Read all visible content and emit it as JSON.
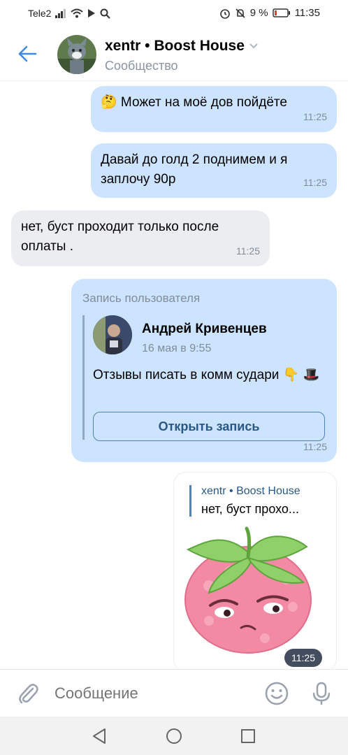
{
  "status_bar": {
    "carrier": "Tele2",
    "battery": "9 %",
    "time": "11:35"
  },
  "header": {
    "title": "xentr • Boost House",
    "subtitle": "Сообщество"
  },
  "messages": [
    {
      "text": "🤔 Может на моё дов пойдёте",
      "time": "11:25",
      "direction": "out"
    },
    {
      "text": "Давай до голд 2 поднимем и я заплочу 90р",
      "time": "11:25",
      "direction": "out"
    },
    {
      "text": "нет, буст проходит только после оплаты .",
      "time": "11:25",
      "direction": "in"
    }
  ],
  "repost": {
    "label": "Запись пользователя",
    "author": "Андрей Кривенцев",
    "date": "16 мая в 9:55",
    "text": "Отзывы писать в комм судари 👇 🎩",
    "button": "Открыть запись",
    "time": "11:25"
  },
  "sticker_message": {
    "reply_author": "xentr • Boost House",
    "reply_text": "нет, буст прохо...",
    "time": "11:25"
  },
  "composer": {
    "placeholder": "Сообщение"
  },
  "colors": {
    "accent": "#2a5885",
    "outgoing_bubble": "#cce4ff",
    "incoming_bubble": "#ebedf0"
  }
}
